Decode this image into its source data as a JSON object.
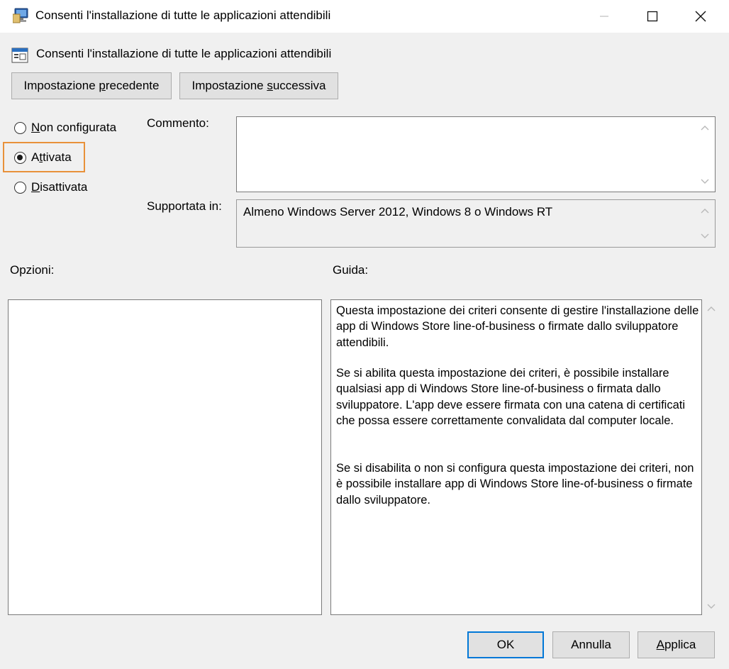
{
  "window": {
    "title": "Consenti l'installazione di tutte le applicazioni attendibili",
    "icon": "policy-editor-icon",
    "controls": [
      "minimize-icon",
      "maximize-icon",
      "close-icon"
    ]
  },
  "setting": {
    "icon": "policy-setting-icon",
    "title": "Consenti l'installazione di tutte le applicazioni attendibili"
  },
  "nav": {
    "prev_pre": "Impostazione ",
    "prev_key": "p",
    "prev_post": "recedente",
    "next_pre": "Impostazione ",
    "next_key": "s",
    "next_post": "uccessiva"
  },
  "state": {
    "selected": "Attivata",
    "options": [
      {
        "key": "N",
        "rest": "on configurata",
        "checked": false
      },
      {
        "pre": "A",
        "key": "t",
        "rest": "tivata",
        "checked": true
      },
      {
        "key": "D",
        "rest": "isattivata",
        "checked": false
      }
    ]
  },
  "comment": {
    "label": "Commento:",
    "value": ""
  },
  "supported": {
    "label": "Supportata in:",
    "value": "Almeno Windows Server 2012, Windows 8 o Windows RT"
  },
  "options_panel": {
    "label": "Opzioni:"
  },
  "help_panel": {
    "label": "Guida:",
    "paragraphs": [
      "Questa impostazione dei criteri consente di gestire l'installazione delle app di Windows Store line-of-business o firmate dallo sviluppatore attendibili.",
      "Se si abilita questa impostazione dei criteri, è possibile installare qualsiasi app di Windows Store line-of-business o firmata dallo sviluppatore. L'app deve essere firmata con una catena di certificati che possa essere correttamente convalidata dal computer locale.",
      "Se si disabilita o non si configura questa impostazione dei criteri, non è possibile installare app di Windows Store line-of-business o firmate dallo sviluppatore."
    ]
  },
  "footer": {
    "ok": "OK",
    "cancel": "Annulla",
    "apply_key": "A",
    "apply_rest": "pplica"
  },
  "colors": {
    "window_bg": "#f0f0f0",
    "focus_highlight": "#e8913a",
    "default_button_border": "#0078d7"
  }
}
